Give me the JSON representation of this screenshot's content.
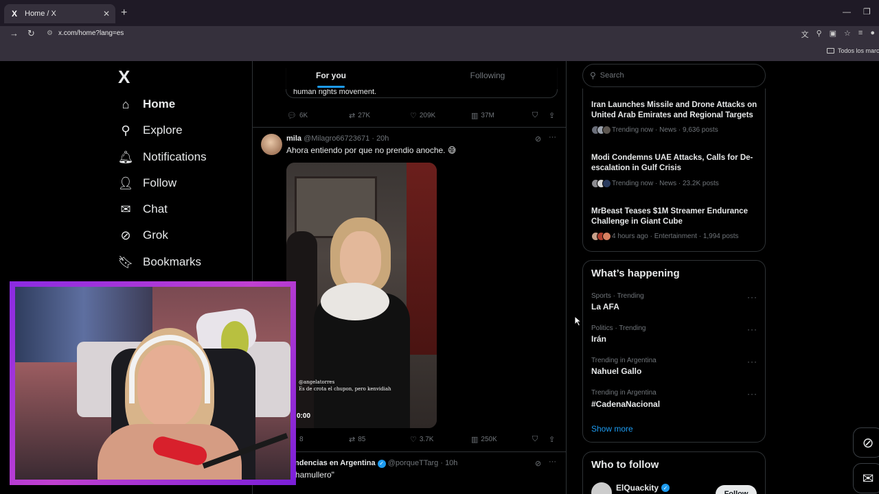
{
  "browser": {
    "tab_title": "Home / X",
    "tab_favicon": "X",
    "url": "x.com/home?lang=es",
    "bookmarks_folder": "Todos los marcadores"
  },
  "nav": {
    "logo": "X",
    "items": [
      {
        "label": "Home",
        "icon": "home-icon",
        "glyph": "⌂",
        "active": true
      },
      {
        "label": "Explore",
        "icon": "search-icon",
        "glyph": "⚲"
      },
      {
        "label": "Notifications",
        "icon": "bell-icon",
        "glyph": "🔔︎"
      },
      {
        "label": "Follow",
        "icon": "add-user-icon",
        "glyph": "👤︎"
      },
      {
        "label": "Chat",
        "icon": "mail-icon",
        "glyph": "✉"
      },
      {
        "label": "Grok",
        "icon": "grok-icon",
        "glyph": "⊘"
      },
      {
        "label": "Bookmarks",
        "icon": "bookmark-icon",
        "glyph": "🔖︎"
      }
    ]
  },
  "feed": {
    "tabs": [
      "For you",
      "Following"
    ],
    "active_tab": "For you",
    "prev_tweet": {
      "quote_text": "human rights movement.",
      "replies": "6K",
      "retweets": "27K",
      "likes": "209K",
      "views": "37M"
    },
    "tweet": {
      "name": "mila",
      "handle": "@Milagro66723671",
      "time": "20h",
      "text": "Ahora entiendo por que no prendio anoche. 😅",
      "video_caption_1": "@angelatorres",
      "video_caption_2": "Es de crota el chupon, pero kenvidiah",
      "video_time": "0:00",
      "replies": "8",
      "retweets": "85",
      "likes": "3.7K",
      "views": "250K"
    },
    "next_tweet": {
      "name": "Tendencias en Argentina",
      "handle": "@porqueTTarg",
      "time": "10h",
      "text": "\"Chamullero\""
    }
  },
  "sidebar": {
    "search_placeholder": "Search",
    "news": [
      {
        "title": "Iran Launches Missile and Drone Attacks on United Arab Emirates and Regional Targets",
        "meta": "Trending now · News · 9,636 posts"
      },
      {
        "title": "Modi Condemns UAE Attacks, Calls for De-escalation in Gulf Crisis",
        "meta": "Trending now · News · 23.2K posts"
      },
      {
        "title": "MrBeast Teases $1M Streamer Endurance Challenge in Giant Cube",
        "meta": "4 hours ago · Entertainment · 1,994 posts"
      }
    ],
    "happening_title": "What’s happening",
    "trends": [
      {
        "context": "Sports · Trending",
        "name": "La AFA"
      },
      {
        "context": "Politics · Trending",
        "name": "Irán"
      },
      {
        "context": "Trending in Argentina",
        "name": "Nahuel Gallo"
      },
      {
        "context": "Trending in Argentina",
        "name": "#CadenaNacional"
      }
    ],
    "show_more": "Show more",
    "who_to_follow_title": "Who to follow",
    "suggestion": {
      "name": "ElQuackity",
      "button": "Follow"
    }
  },
  "colors": {
    "accent": "#1d9bf0",
    "background": "#000000",
    "border": "#2f3336",
    "secondary_text": "#71767b",
    "webcam_frame": "#a335e0"
  }
}
